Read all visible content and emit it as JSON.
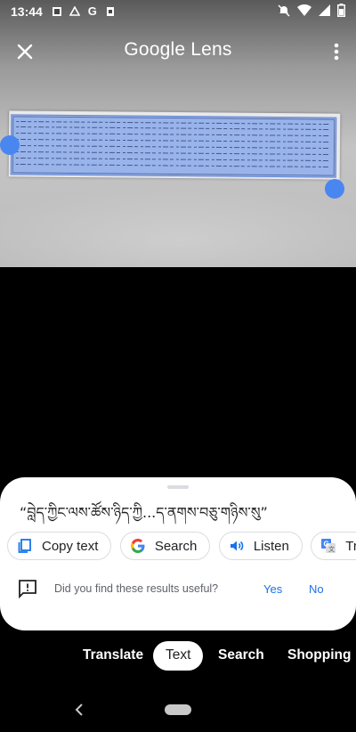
{
  "status_bar": {
    "time": "13:44",
    "left_icons": [
      "image-icon",
      "drive-icon",
      "google-g-icon",
      "sim-icon"
    ],
    "right_icons": [
      "mute-icon",
      "wifi-icon",
      "cell-signal-icon",
      "battery-icon"
    ]
  },
  "header": {
    "title": "Google Lens",
    "close_icon": "close-icon",
    "menu_icon": "more-vert-icon"
  },
  "result": {
    "text": "“བླེད་ཀྱིང་ལས་ཚོས་ཉིད་ཀྱི...ད་ནགས་བཅུ་གཉིས་སུ”",
    "chips": [
      {
        "label": "Copy text",
        "icon": "copy-icon"
      },
      {
        "label": "Search",
        "icon": "google-g-icon"
      },
      {
        "label": "Listen",
        "icon": "speaker-icon"
      },
      {
        "label": "Tran",
        "icon": "translate-icon"
      }
    ],
    "feedback": {
      "question": "Did you find these results useful?",
      "yes": "Yes",
      "no": "No"
    }
  },
  "modes": {
    "items": [
      "Translate",
      "Text",
      "Search",
      "Shopping"
    ],
    "active": "Text"
  },
  "colors": {
    "accent": "#1a73e8",
    "handle": "#4a86f0",
    "highlight": "#78a0eb"
  }
}
